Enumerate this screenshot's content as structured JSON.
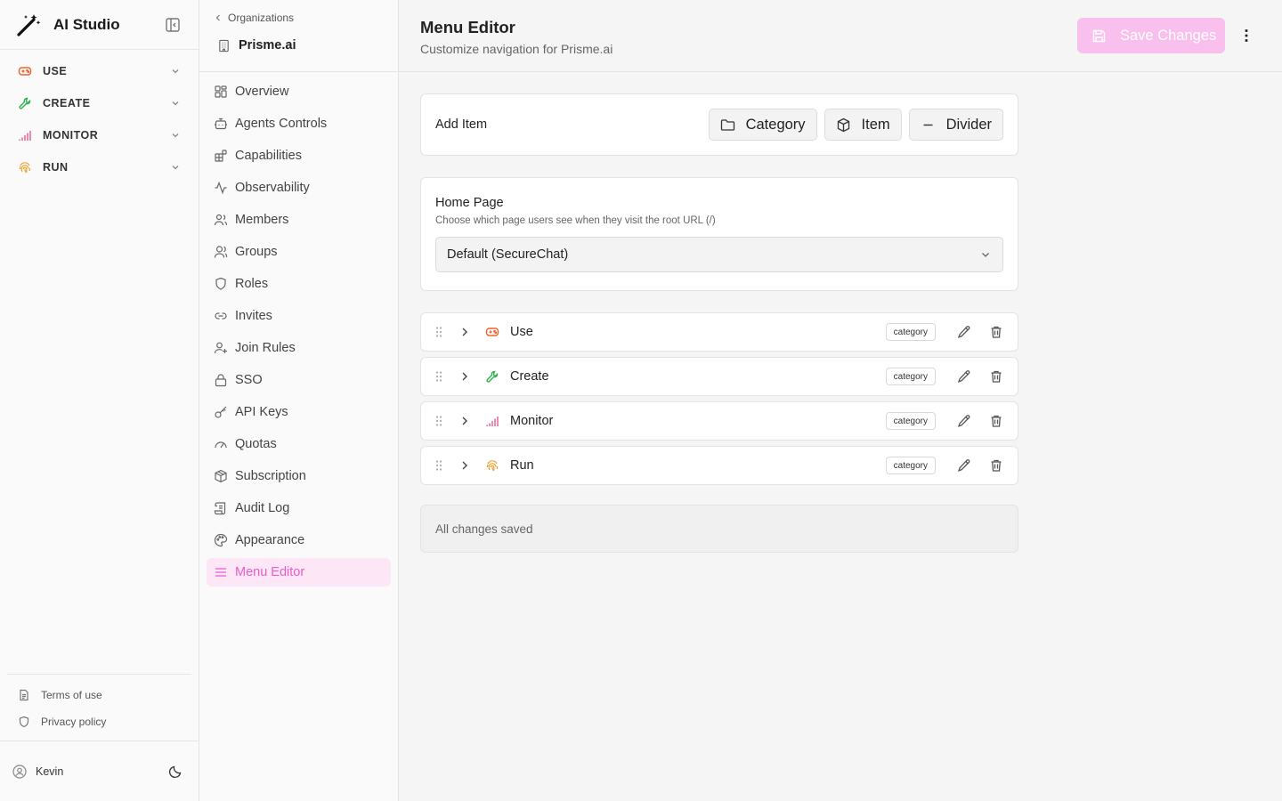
{
  "app": {
    "title": "AI Studio"
  },
  "top_nav": [
    {
      "label": "USE",
      "icon": "gamepad-icon",
      "color": "#f0622c"
    },
    {
      "label": "CREATE",
      "icon": "wrench-icon",
      "color": "#2eae4e"
    },
    {
      "label": "MONITOR",
      "icon": "signal-bars-icon",
      "color": "#e84e8a"
    },
    {
      "label": "RUN",
      "icon": "fingerprint-icon",
      "color": "#f0a030"
    }
  ],
  "footer": {
    "terms": "Terms of use",
    "privacy": "Privacy policy",
    "user": "Kevin"
  },
  "settings": {
    "breadcrumb": "Organizations",
    "org_name": "Prisme.ai",
    "nav": [
      {
        "label": "Overview",
        "icon": "grid-icon"
      },
      {
        "label": "Agents Controls",
        "icon": "bot-icon"
      },
      {
        "label": "Capabilities",
        "icon": "blocks-icon"
      },
      {
        "label": "Observability",
        "icon": "activity-icon"
      },
      {
        "label": "Members",
        "icon": "users-icon"
      },
      {
        "label": "Groups",
        "icon": "user-group-icon"
      },
      {
        "label": "Roles",
        "icon": "shield-icon"
      },
      {
        "label": "Invites",
        "icon": "link-icon"
      },
      {
        "label": "Join Rules",
        "icon": "user-plus-icon"
      },
      {
        "label": "SSO",
        "icon": "lock-icon"
      },
      {
        "label": "API Keys",
        "icon": "key-icon"
      },
      {
        "label": "Quotas",
        "icon": "gauge-icon"
      },
      {
        "label": "Subscription",
        "icon": "package-icon"
      },
      {
        "label": "Audit Log",
        "icon": "scroll-icon"
      },
      {
        "label": "Appearance",
        "icon": "palette-icon"
      },
      {
        "label": "Menu Editor",
        "icon": "menu-icon",
        "active": true
      }
    ]
  },
  "main": {
    "title": "Menu Editor",
    "subtitle": "Customize navigation for Prisme.ai",
    "save_label": "Save Changes",
    "accent_color": "#e85ccb",
    "add_item": {
      "label": "Add Item",
      "buttons": [
        {
          "label": "Category",
          "icon": "folder-icon"
        },
        {
          "label": "Item",
          "icon": "box-icon"
        },
        {
          "label": "Divider",
          "icon": "minus-icon"
        }
      ]
    },
    "home_page": {
      "title": "Home Page",
      "description": "Choose which page users see when they visit the root URL (/)",
      "selected": "Default (SecureChat)"
    },
    "menu_items": [
      {
        "label": "Use",
        "badge": "category",
        "icon": "gamepad-icon",
        "color": "#f0622c"
      },
      {
        "label": "Create",
        "badge": "category",
        "icon": "wrench-icon",
        "color": "#2eae4e"
      },
      {
        "label": "Monitor",
        "badge": "category",
        "icon": "signal-bars-icon",
        "color": "#e84e8a"
      },
      {
        "label": "Run",
        "badge": "category",
        "icon": "fingerprint-icon",
        "color": "#f0a030"
      }
    ],
    "status": "All changes saved"
  }
}
